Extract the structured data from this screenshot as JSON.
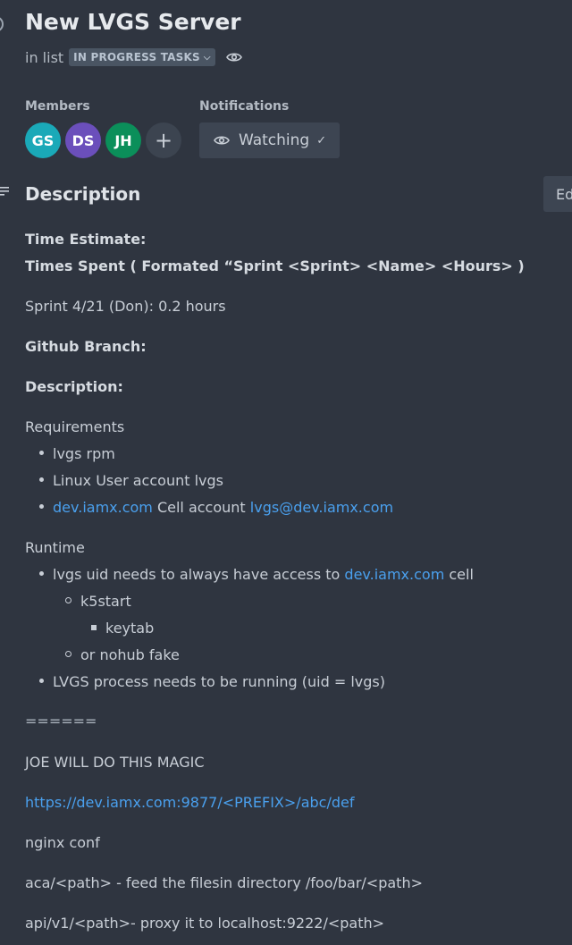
{
  "header": {
    "title": "New LVGS Server",
    "in_list_prefix": "in list",
    "list_name": "IN PROGRESS TASKS"
  },
  "members": {
    "label": "Members",
    "avatars": [
      {
        "initials": "GS",
        "color": "#1aa9b8"
      },
      {
        "initials": "DS",
        "color": "#6b4fbb"
      },
      {
        "initials": "JH",
        "color": "#0b8f5a"
      }
    ],
    "add_label": "+"
  },
  "notifications": {
    "label": "Notifications",
    "button_label": "Watching"
  },
  "description": {
    "title": "Description",
    "edit_label": "Ed",
    "time_estimate": "Time Estimate:",
    "times_spent": "Times Spent (  Formated “Sprint <Sprint> <Name> <Hours> )",
    "sprint_entry": "Sprint 4/21 (Don): 0.2 hours",
    "github_branch": "Github Branch:",
    "description_label": "Description:",
    "requirements_label": "Requirements",
    "requirements": {
      "item1": "lvgs rpm",
      "item2": "Linux User account lvgs",
      "item3_link1": "dev.iamx.com",
      "item3_text": " Cell  account ",
      "item3_link2": "lvgs@dev.iamx.com"
    },
    "runtime_label": "Runtime",
    "runtime": {
      "item1_pre": "lvgs uid needs to always have access to ",
      "item1_link": "dev.iamx.com",
      "item1_post": " cell",
      "sub1": "k5start",
      "sub1_sub": "keytab",
      "sub2": "or nohub fake",
      "item2": "LVGS process needs to be running (uid = lvgs)"
    },
    "separator": "======",
    "joe_line": "JOE WILL DO THIS MAGIC",
    "url_link": "https://dev.iamx.com:9877/<PREFIX>/abc/def",
    "nginx_conf": "nginx conf",
    "aca_line": "aca/<path>  - feed the filesin directory /foo/bar/<path>",
    "api_line": "api/v1/<path>- proxy it to localhost:9222/<path>"
  },
  "colors": {
    "background": "#2f3540",
    "link": "#4aa0ee",
    "button_bg": "#3d4552"
  }
}
